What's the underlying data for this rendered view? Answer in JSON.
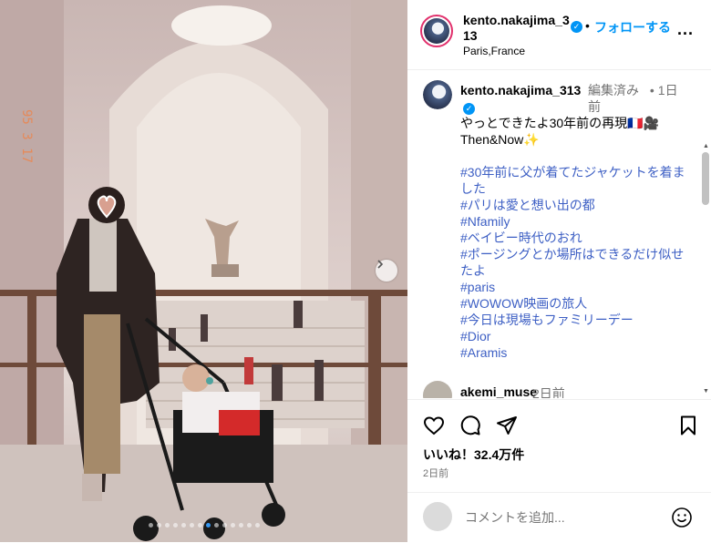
{
  "post": {
    "username": "kento.nakajima_313",
    "follow_label": "フォローする",
    "separator": "•",
    "location": "Paris,France",
    "more_label": "...",
    "photo_date_stamp": "95 3 17",
    "carousel": {
      "total": 14,
      "active_index": 7
    }
  },
  "caption": {
    "username": "kento.nakajima_313",
    "edited": "編集済み",
    "separator": "•",
    "time": "1日前",
    "line1": "やっとできたよ30年前の再現🇫🇷🎥",
    "line2": "Then&Now✨",
    "hashtags": [
      "#30年前に父が着てたジャケットを着ました",
      "#パリは愛と想い出の都",
      "#Nfamily",
      "#ベイビー時代のおれ",
      "#ポージングとか場所はできるだけ似せたよ",
      "#paris",
      "#WOWOW映画の旅人",
      "#今日は現場もファミリーデー",
      "#Dior",
      "#Aramis"
    ]
  },
  "comment2": {
    "username": "akemi_muse",
    "time": "2日前"
  },
  "actions": {
    "icons": [
      "heart-icon",
      "comment-icon",
      "share-icon",
      "bookmark-icon"
    ],
    "likes": "いいね！32.4万件",
    "posted_ago": "2日前"
  },
  "add_comment": {
    "placeholder": "コメントを追加..."
  },
  "colors": {
    "accent": "#0095f6",
    "hashtag": "#3d5fc4",
    "muted": "#737373"
  }
}
